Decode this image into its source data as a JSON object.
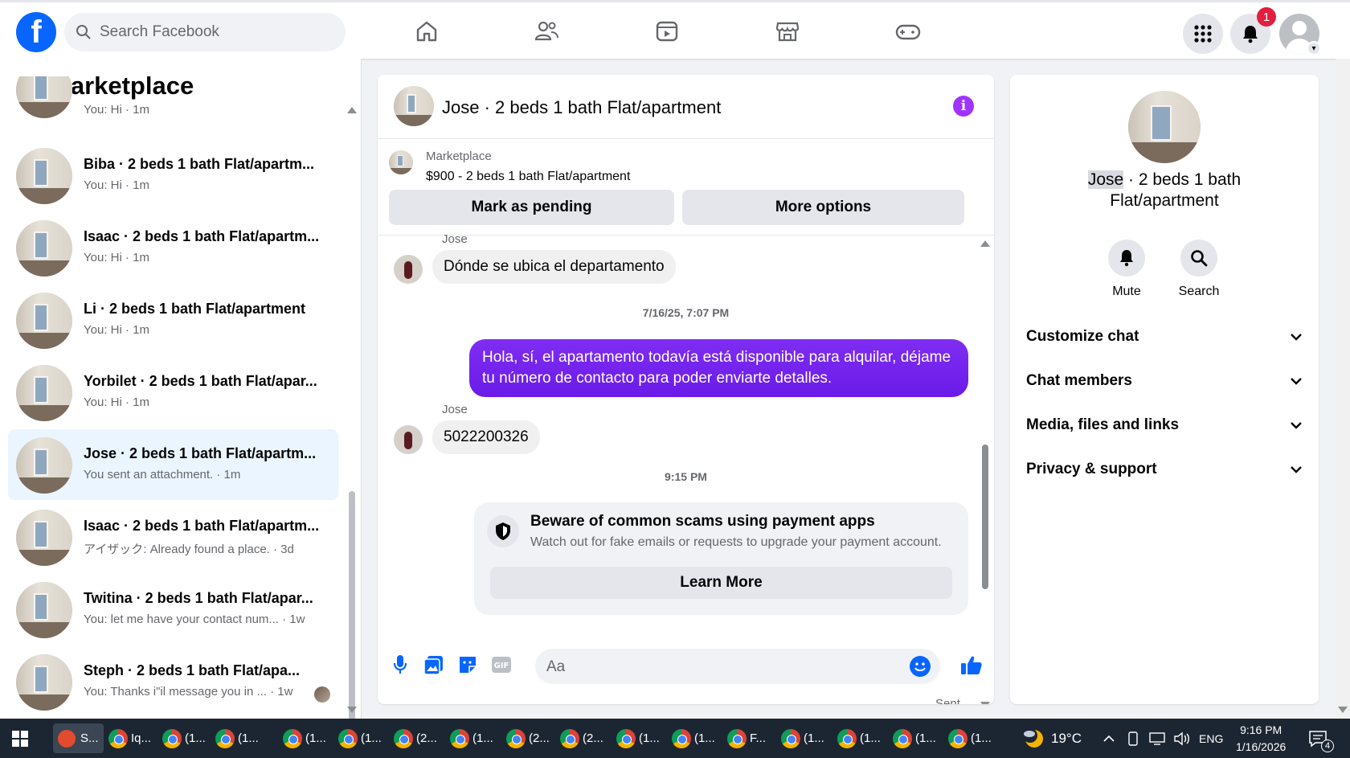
{
  "topbar": {
    "logo": "f",
    "search_placeholder": "Search Facebook",
    "notification_count": "1"
  },
  "sidebar": {
    "title": "Marketplace",
    "partial_top": {
      "sub": "You: Hi · 1m"
    },
    "conversations": [
      {
        "name": "Biba · 2 beds 1 bath Flat/apartm...",
        "sub": "You: Hi · 1m"
      },
      {
        "name": "Isaac · 2 beds 1 bath Flat/apartm...",
        "sub": "You: Hi · 1m"
      },
      {
        "name": "Li · 2 beds 1 bath Flat/apartment",
        "sub": "You: Hi · 1m"
      },
      {
        "name": "Yorbilet · 2 beds 1 bath Flat/apar...",
        "sub": "You: Hi · 1m"
      },
      {
        "name": "Jose · 2 beds 1 bath Flat/apartm...",
        "sub": "You sent an attachment. · 1m",
        "active": true
      },
      {
        "name": "Isaac · 2 beds 1 bath Flat/apartm...",
        "sub": "アイザック: Already found a place. · 3d"
      },
      {
        "name": "Twitina · 2 beds 1 bath Flat/apar...",
        "sub": "You: let me have your contact num... · 1w"
      },
      {
        "name": "Steph · 2 beds 1 bath Flat/apa...",
        "sub": "You: Thanks i\"il message you in ... · 1w"
      }
    ]
  },
  "chat": {
    "title": "Jose · 2 beds 1 bath Flat/apartment",
    "listing": {
      "label": "Marketplace",
      "price_line": "$900 - 2 beds 1 bath Flat/apartment",
      "mark_pending": "Mark as pending",
      "more_options": "More options"
    },
    "messages": {
      "sender1": "Jose",
      "msg1": "Dónde se ubica el departamento",
      "ts1": "7/16/25, 7:07 PM",
      "out1": "Hola, sí, el apartamento todavía está disponible para alquilar, déjame tu número de contacto para poder enviarte detalles.",
      "sender2": "Jose",
      "msg2": "5022200326",
      "ts2": "9:15 PM"
    },
    "scam": {
      "title": "Beware of common scams using payment apps",
      "desc": "Watch out for fake emails or requests to upgrade your payment account.",
      "button": "Learn More"
    },
    "sent_label": "Sent",
    "composer_placeholder": "Aa"
  },
  "right_panel": {
    "title_highlight": "Jose",
    "title_rest_line1": " · 2 beds 1 bath",
    "title_line2": "Flat/apartment",
    "actions": [
      {
        "label": "Mute",
        "icon": "bell-icon"
      },
      {
        "label": "Search",
        "icon": "search-icon"
      }
    ],
    "sections": [
      "Customize chat",
      "Chat members",
      "Media, files and links",
      "Privacy & support"
    ]
  },
  "taskbar": {
    "items": [
      "S...",
      "Iq...",
      "(1...",
      "(1...",
      "(1...",
      "(1...",
      "(2...",
      "(1...",
      "(2...",
      "(2...",
      "(1...",
      "(1...",
      "F...",
      "(1...",
      "(1...",
      "(1...",
      "(1..."
    ],
    "weather": "19°C",
    "lang": "ENG",
    "time": "9:16 PM",
    "date": "1/16/2026",
    "notif_count": "4"
  },
  "colors": {
    "brand": "#0866ff",
    "outgoing_bubble": "#7a1ff2",
    "info": "#a033ff"
  }
}
